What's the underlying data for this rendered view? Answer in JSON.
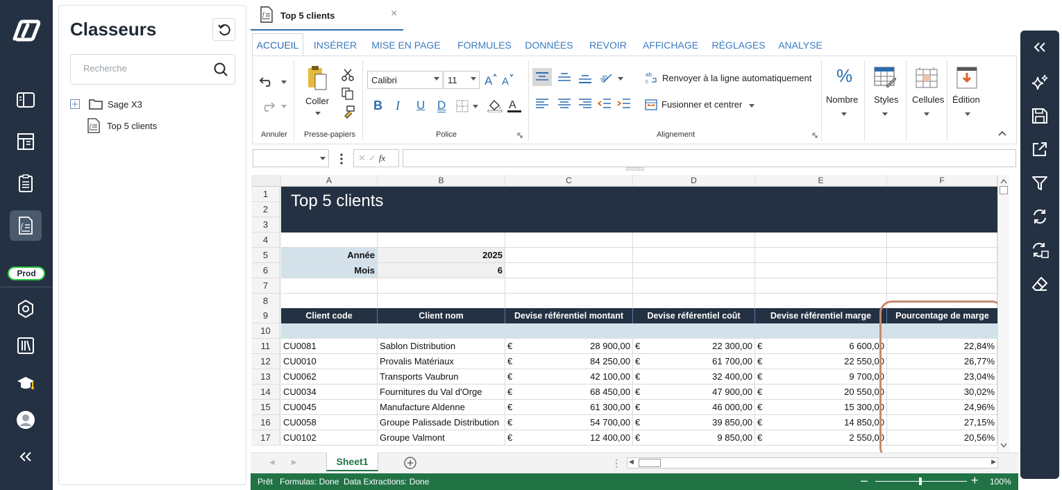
{
  "app": {
    "prod_badge": "Prod"
  },
  "workbook_panel": {
    "title": "Classeurs",
    "search_placeholder": "Recherche",
    "tree": [
      {
        "label": "Sage X3",
        "type": "folder"
      },
      {
        "label": "Top 5 clients",
        "type": "workbook"
      }
    ]
  },
  "document_tab": {
    "label": "Top 5 clients",
    "close": "×"
  },
  "ribbon": {
    "tabs": [
      "ACCUEIL",
      "INSÉRER",
      "MISE EN PAGE",
      "FORMULES",
      "DONNÉES",
      "REVOIR",
      "AFFICHAGE",
      "RÉGLAGES",
      "ANALYSE"
    ],
    "active_tab": "ACCUEIL",
    "groups": {
      "annuler": "Annuler",
      "presse_papiers": "Presse-papiers",
      "police": "Police",
      "alignement": "Alignement"
    },
    "coller": "Coller",
    "font_name": "Calibri",
    "font_size": "11",
    "bold": "B",
    "italic": "I",
    "underline": "U",
    "double_underline": "D",
    "wrap_text": "Renvoyer à la ligne automatiquement",
    "merge_center": "Fusionner et centrer",
    "nombre": "Nombre",
    "styles": "Styles",
    "cellules": "Cellules",
    "edition": "Édition",
    "percent_symbol": "%"
  },
  "formula_bar": {
    "name_box": "",
    "fx": "fx",
    "formula": ""
  },
  "sheet": {
    "columns": [
      "A",
      "B",
      "C",
      "D",
      "E",
      "F"
    ],
    "rows": [
      "1",
      "2",
      "3",
      "4",
      "5",
      "6",
      "7",
      "8",
      "9",
      "10",
      "11",
      "12",
      "13",
      "14",
      "15",
      "16",
      "17"
    ],
    "title": "Top 5 clients",
    "params": [
      {
        "label": "Année",
        "value": "2025"
      },
      {
        "label": "Mois",
        "value": "6"
      }
    ],
    "headers": [
      "Client code",
      "Client nom",
      "Devise référentiel montant",
      "Devise référentiel coût",
      "Devise référentiel marge",
      "Pourcentage de marge"
    ],
    "currency": "€",
    "records": [
      {
        "code": "CU0081",
        "name": "Sablon Distribution",
        "amount": "28 900,00",
        "cost": "22 300,00",
        "margin": "6 600,00",
        "pct": "22,84%"
      },
      {
        "code": "CU0010",
        "name": "Provalis Matériaux",
        "amount": "84 250,00",
        "cost": "61 700,00",
        "margin": "22 550,00",
        "pct": "26,77%"
      },
      {
        "code": "CU0062",
        "name": "Transports Vaubrun",
        "amount": "42 100,00",
        "cost": "32 400,00",
        "margin": "9 700,00",
        "pct": "23,04%"
      },
      {
        "code": "CU0034",
        "name": "Fournitures du Val d'Orge",
        "amount": "68 450,00",
        "cost": "47 900,00",
        "margin": "20 550,00",
        "pct": "30,02%"
      },
      {
        "code": "CU0045",
        "name": "Manufacture Aldenne",
        "amount": "61 300,00",
        "cost": "46 000,00",
        "margin": "15 300,00",
        "pct": "24,96%"
      },
      {
        "code": "CU0058",
        "name": "Groupe Palissade Distribution",
        "amount": "54 700,00",
        "cost": "39 850,00",
        "margin": "14 850,00",
        "pct": "27,15%"
      },
      {
        "code": "CU0102",
        "name": "Groupe Valmont",
        "amount": "12 400,00",
        "cost": "9 850,00",
        "margin": "2 550,00",
        "pct": "20,56%"
      }
    ]
  },
  "sheet_tabs": {
    "active": "Sheet1"
  },
  "status_bar": {
    "ready": "Prêt",
    "formulas": "Formulas: Done",
    "extractions": "Data Extractions: Done",
    "zoom": "100%"
  },
  "colors": {
    "nav_dark": "#243142",
    "accent_blue": "#3a7bbf",
    "excel_green": "#217346",
    "param_blue": "#d3e1ea",
    "highlight": "#c58b6e"
  }
}
